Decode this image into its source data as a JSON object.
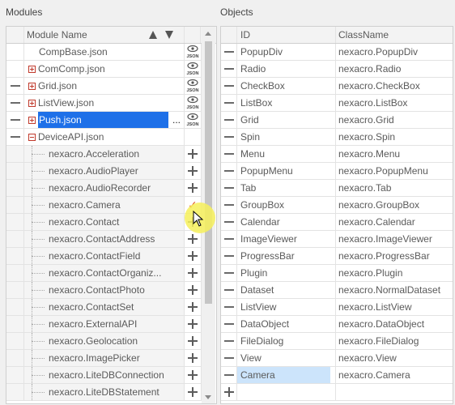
{
  "modules_panel": {
    "title": "Modules",
    "header": {
      "module_name": "Module Name"
    },
    "rows": [
      {
        "name": "CompBase.json",
        "level": 0,
        "expander": "none",
        "dash": false,
        "action": "json"
      },
      {
        "name": "ComComp.json",
        "level": 0,
        "expander": "plus",
        "dash": false,
        "action": "json"
      },
      {
        "name": "Grid.json",
        "level": 0,
        "expander": "plus",
        "dash": true,
        "action": "json"
      },
      {
        "name": "ListView.json",
        "level": 0,
        "expander": "plus",
        "dash": true,
        "action": "json"
      },
      {
        "name": "Push.json",
        "level": 0,
        "expander": "plus",
        "dash": true,
        "action": "json",
        "selected": true,
        "more": "..."
      },
      {
        "name": "DeviceAPI.json",
        "level": 0,
        "expander": "minus",
        "dash": true,
        "action": "none"
      },
      {
        "name": "nexacro.Acceleration",
        "level": 1,
        "action": "plus"
      },
      {
        "name": "nexacro.AudioPlayer",
        "level": 1,
        "action": "plus"
      },
      {
        "name": "nexacro.AudioRecorder",
        "level": 1,
        "action": "plus"
      },
      {
        "name": "nexacro.Camera",
        "level": 1,
        "action": "check"
      },
      {
        "name": "nexacro.Contact",
        "level": 1,
        "action": "plus"
      },
      {
        "name": "nexacro.ContactAddress",
        "level": 1,
        "action": "plus"
      },
      {
        "name": "nexacro.ContactField",
        "level": 1,
        "action": "plus"
      },
      {
        "name": "nexacro.ContactOrganiz...",
        "level": 1,
        "action": "plus"
      },
      {
        "name": "nexacro.ContactPhoto",
        "level": 1,
        "action": "plus"
      },
      {
        "name": "nexacro.ContactSet",
        "level": 1,
        "action": "plus"
      },
      {
        "name": "nexacro.ExternalAPI",
        "level": 1,
        "action": "plus"
      },
      {
        "name": "nexacro.Geolocation",
        "level": 1,
        "action": "plus"
      },
      {
        "name": "nexacro.ImagePicker",
        "level": 1,
        "action": "plus"
      },
      {
        "name": "nexacro.LiteDBConnection",
        "level": 1,
        "action": "plus"
      },
      {
        "name": "nexacro.LiteDBStatement",
        "level": 1,
        "action": "plus"
      }
    ],
    "json_icon_text": "JSON"
  },
  "objects_panel": {
    "title": "Objects",
    "header": {
      "id": "ID",
      "classname": "ClassName"
    },
    "rows": [
      {
        "id": "PopupDiv",
        "classname": "nexacro.PopupDiv"
      },
      {
        "id": "Radio",
        "classname": "nexacro.Radio"
      },
      {
        "id": "CheckBox",
        "classname": "nexacro.CheckBox"
      },
      {
        "id": "ListBox",
        "classname": "nexacro.ListBox"
      },
      {
        "id": "Grid",
        "classname": "nexacro.Grid"
      },
      {
        "id": "Spin",
        "classname": "nexacro.Spin"
      },
      {
        "id": "Menu",
        "classname": "nexacro.Menu"
      },
      {
        "id": "PopupMenu",
        "classname": "nexacro.PopupMenu"
      },
      {
        "id": "Tab",
        "classname": "nexacro.Tab"
      },
      {
        "id": "GroupBox",
        "classname": "nexacro.GroupBox"
      },
      {
        "id": "Calendar",
        "classname": "nexacro.Calendar"
      },
      {
        "id": "ImageViewer",
        "classname": "nexacro.ImageViewer"
      },
      {
        "id": "ProgressBar",
        "classname": "nexacro.ProgressBar"
      },
      {
        "id": "Plugin",
        "classname": "nexacro.Plugin"
      },
      {
        "id": "Dataset",
        "classname": "nexacro.NormalDataset"
      },
      {
        "id": "ListView",
        "classname": "nexacro.ListView"
      },
      {
        "id": "DataObject",
        "classname": "nexacro.DataObject"
      },
      {
        "id": "FileDialog",
        "classname": "nexacro.FileDialog"
      },
      {
        "id": "View",
        "classname": "nexacro.View"
      },
      {
        "id": "Camera",
        "classname": "nexacro.Camera",
        "highlight": true
      }
    ]
  },
  "colors": {
    "selection": "#1e70e8",
    "highlight": "#cce4fb",
    "check": "#e05a2a",
    "cursor_halo": "#f6f05a"
  }
}
